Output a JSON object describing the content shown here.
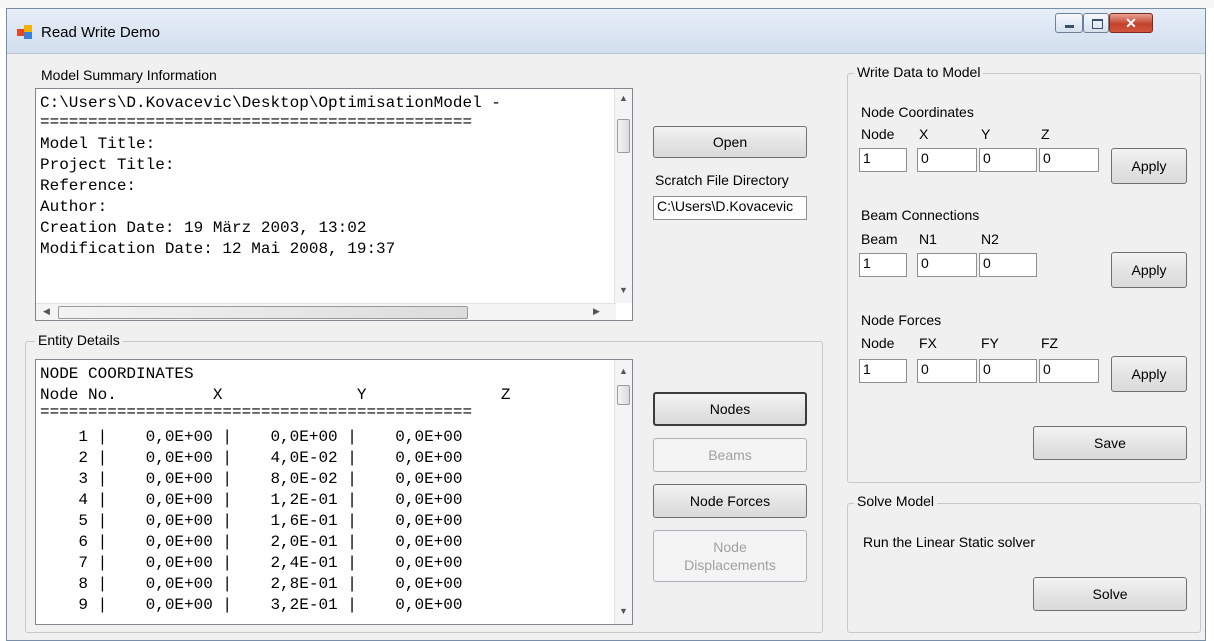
{
  "window": {
    "title": "Read Write Demo"
  },
  "summary": {
    "label": "Model Summary Information",
    "lines": [
      "C:\\Users\\D.Kovacevic\\Desktop\\OptimisationModel -",
      "=============================================",
      "Model Title:",
      "Project Title:",
      "Reference:",
      "Author:",
      "Creation Date: 19 März 2003, 13:02",
      "Modification Date: 12 Mai 2008, 19:37"
    ]
  },
  "open_button": "Open",
  "scratch": {
    "label": "Scratch File Directory",
    "value": "C:\\Users\\D.Kovacevic"
  },
  "entity": {
    "label": "Entity Details",
    "lines": [
      "NODE COORDINATES",
      "Node No.          X              Y              Z",
      "=============================================",
      "    1 |    0,0E+00 |    0,0E+00 |    0,0E+00",
      "    2 |    0,0E+00 |    4,0E-02 |    0,0E+00",
      "    3 |    0,0E+00 |    8,0E-02 |    0,0E+00",
      "    4 |    0,0E+00 |    1,2E-01 |    0,0E+00",
      "    5 |    0,0E+00 |    1,6E-01 |    0,0E+00",
      "    6 |    0,0E+00 |    2,0E-01 |    0,0E+00",
      "    7 |    0,0E+00 |    2,4E-01 |    0,0E+00",
      "    8 |    0,0E+00 |    2,8E-01 |    0,0E+00",
      "    9 |    0,0E+00 |    3,2E-01 |    0,0E+00"
    ]
  },
  "entity_buttons": {
    "nodes": "Nodes",
    "beams": "Beams",
    "node_forces": "Node Forces",
    "node_displacements_1": "Node",
    "node_displacements_2": "Displacements"
  },
  "write": {
    "label": "Write Data to Model",
    "node_coords": {
      "title": "Node Coordinates",
      "headers": [
        "Node",
        "X",
        "Y",
        "Z"
      ],
      "values": [
        "1",
        "0",
        "0",
        "0"
      ]
    },
    "beam_conn": {
      "title": "Beam Connections",
      "headers": [
        "Beam",
        "N1",
        "N2"
      ],
      "values": [
        "1",
        "0",
        "0"
      ]
    },
    "node_forces": {
      "title": "Node Forces",
      "headers": [
        "Node",
        "FX",
        "FY",
        "FZ"
      ],
      "values": [
        "1",
        "0",
        "0",
        "0"
      ]
    },
    "apply": "Apply",
    "save": "Save"
  },
  "solve": {
    "label": "Solve Model",
    "description": "Run the Linear Static solver",
    "button": "Solve"
  }
}
